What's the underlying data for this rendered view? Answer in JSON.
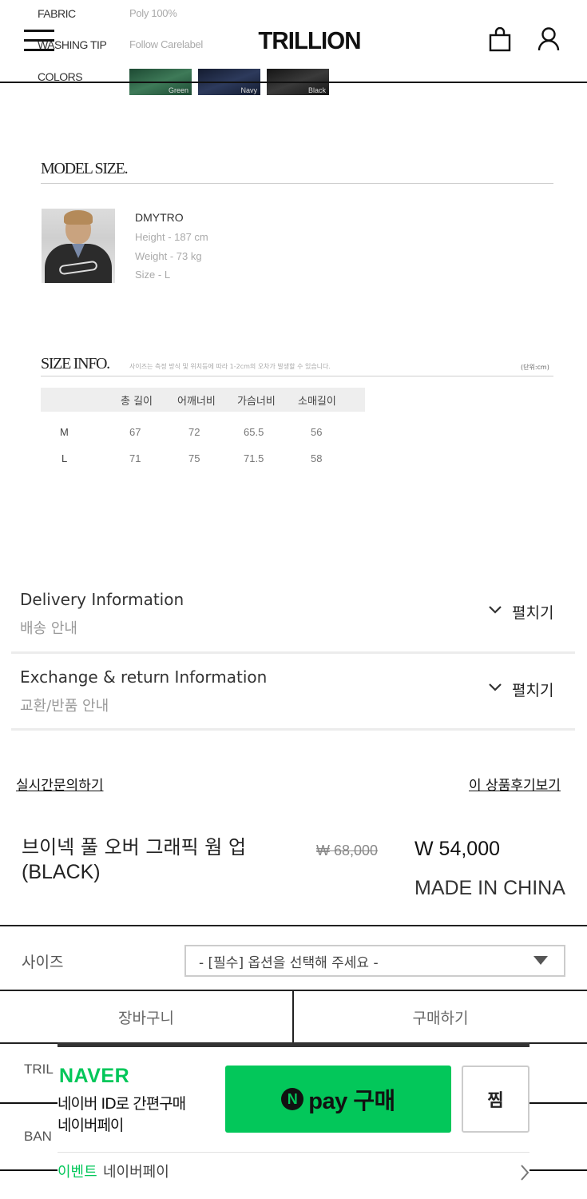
{
  "header": {
    "logo_text": "TRILLION"
  },
  "specs": [
    {
      "label": "FABRIC",
      "value": "Poly 100%"
    },
    {
      "label": "WASHING TIP",
      "value": "Follow Carelabel"
    },
    {
      "label": "COLORS",
      "value": ""
    }
  ],
  "colors": [
    {
      "name": "Green",
      "hex": "#2e5f44"
    },
    {
      "name": "Navy",
      "hex": "#1f2a44"
    },
    {
      "name": "Black",
      "hex": "#232323"
    }
  ],
  "model_size": {
    "title": "MODEL SIZE.",
    "name": "DMYTRO",
    "height": "Height - 187 cm",
    "weight": "Weight - 73 kg",
    "size": "Size - L"
  },
  "size_info": {
    "title": "SIZE INFO.",
    "note": "사이즈는 측정 방식 및 위치등에 따라 1-2cm의 오차가 발생할 수 있습니다.",
    "unit": "(단위:cm)",
    "headers": [
      "총 길이",
      "어깨너비",
      "가슴너비",
      "소매길이"
    ],
    "rows": [
      {
        "size": "M",
        "values": [
          "67",
          "72",
          "65.5",
          "56"
        ]
      },
      {
        "size": "L",
        "values": [
          "71",
          "75",
          "71.5",
          "58"
        ]
      }
    ]
  },
  "accordions": [
    {
      "title": "Delivery Information",
      "subtitle": "배송 안내",
      "toggle": "펼치기"
    },
    {
      "title": "Exchange & return Information",
      "subtitle": "교환/반품 안내",
      "toggle": "펼치기"
    }
  ],
  "links": {
    "live_inquiry": "실시간문의하기",
    "reviews": "이 상품후기보기"
  },
  "product": {
    "name_line1": "브이넥 풀 오버 그래픽 웜 업",
    "name_line2": "(BLACK)",
    "original_price": "₩ 68,000",
    "price": "W 54,000",
    "origin": "MADE IN CHINA"
  },
  "options": {
    "size_label": "사이즈",
    "size_placeholder": "- [필수] 옵션을 선택해 주세요 -"
  },
  "actions": {
    "cart": "장바구니",
    "buy": "구매하기"
  },
  "naverpay": {
    "brand": "NAVER",
    "line1": "네이버 ID로 간편구매",
    "line2": "네이버페이",
    "pay_label": "pay 구매",
    "zzim": "찜",
    "event_label": "이벤트",
    "event_text": "네이버페이"
  },
  "footer_peek": {
    "item1": "TRIL",
    "item2": "BAN"
  }
}
